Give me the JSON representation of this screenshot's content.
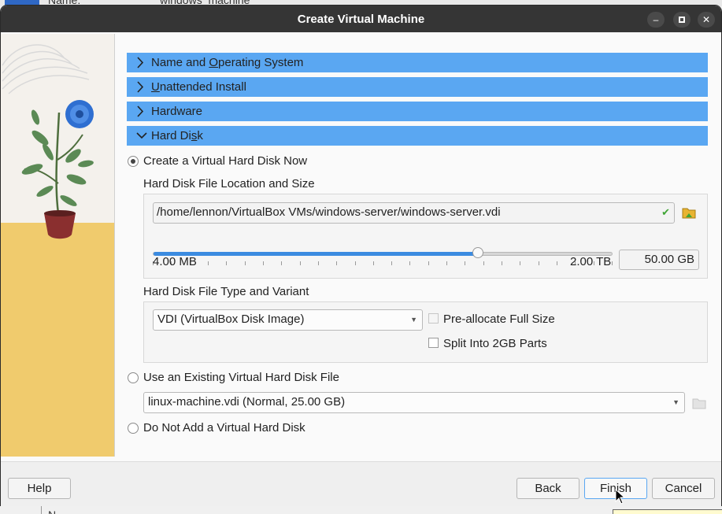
{
  "background": {
    "name_label_top": "Name:",
    "name_value_top": "windows_machine",
    "name_label_bottom": "N"
  },
  "window": {
    "title": "Create Virtual Machine",
    "minimize_icon": "minimize-icon",
    "maximize_icon": "maximize-icon",
    "close_icon": "close-icon"
  },
  "sections": [
    {
      "label": "Name and Operating System",
      "mnemonic_index": 9,
      "expanded": false
    },
    {
      "label": "Unattended Install",
      "mnemonic_index": 0,
      "expanded": false
    },
    {
      "label": "Hardware",
      "mnemonic_index": -1,
      "expanded": false
    },
    {
      "label": "Hard Disk",
      "mnemonic_index": 7,
      "expanded": true
    }
  ],
  "hard_disk": {
    "options": {
      "create_new": {
        "label": "Create a Virtual Hard Disk Now",
        "selected": true
      },
      "use_existing": {
        "label": "Use an Existing Virtual Hard Disk File",
        "selected": false
      },
      "none": {
        "label": "Do Not Add a Virtual Hard Disk",
        "selected": false
      }
    },
    "location_group_label": "Hard Disk File Location and Size",
    "file_path": "/home/lennon/VirtualBox VMs/windows-server/windows-server.vdi",
    "size": {
      "value": "50.00 GB",
      "min_label": "4.00 MB",
      "max_label": "2.00 TB",
      "slider_fraction": 0.706
    },
    "type_group_label": "Hard Disk File Type and Variant",
    "disk_type": "VDI (VirtualBox Disk Image)",
    "preallocate": {
      "label": "Pre-allocate Full Size",
      "checked": false,
      "enabled": false
    },
    "split": {
      "label": "Split Into 2GB Parts",
      "checked": false,
      "enabled": true
    },
    "existing_file": "linux-machine.vdi (Normal, 25.00 GB)"
  },
  "buttons": {
    "help": "Help",
    "back": "Back",
    "finish": "Finish",
    "cancel": "Cancel"
  },
  "colors": {
    "section_header": "#5aa7f2",
    "titlebar": "#353535",
    "slider_fill": "#3b8be0"
  }
}
